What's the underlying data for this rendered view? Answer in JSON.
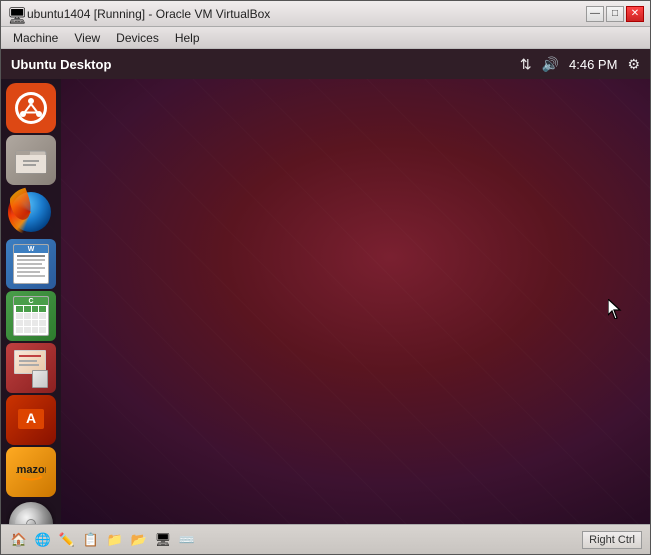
{
  "window": {
    "title": "ubuntu1404 [Running] - Oracle VM VirtualBox",
    "icon": "🖥"
  },
  "menu": {
    "items": [
      "Machine",
      "View",
      "Devices",
      "Help"
    ]
  },
  "ubuntu_top_bar": {
    "title": "Ubuntu Desktop",
    "time": "4:46 PM",
    "icons": [
      "arrows-updown",
      "volume",
      "settings-gear"
    ]
  },
  "launcher_icons": [
    {
      "id": "ubuntu-logo",
      "label": "Ubuntu Logo",
      "type": "ubuntu"
    },
    {
      "id": "files",
      "label": "Files",
      "type": "files"
    },
    {
      "id": "firefox",
      "label": "Firefox",
      "type": "firefox"
    },
    {
      "id": "writer",
      "label": "LibreOffice Writer",
      "type": "writer"
    },
    {
      "id": "calc",
      "label": "LibreOffice Calc",
      "type": "calc"
    },
    {
      "id": "impress",
      "label": "LibreOffice Impress",
      "type": "impress"
    },
    {
      "id": "appstore",
      "label": "Ubuntu Software Center",
      "type": "appstore"
    },
    {
      "id": "amazon",
      "label": "Amazon",
      "type": "amazon"
    },
    {
      "id": "disc",
      "label": "Disc Drive",
      "type": "disc"
    }
  ],
  "bottom_bar": {
    "right_ctrl_label": "Right Ctrl",
    "icons": [
      "home",
      "network",
      "edit",
      "copy",
      "folder",
      "folder2",
      "monitor",
      "keyboard"
    ]
  },
  "title_bar_controls": {
    "minimize": "—",
    "maximize": "□",
    "close": "✕"
  }
}
